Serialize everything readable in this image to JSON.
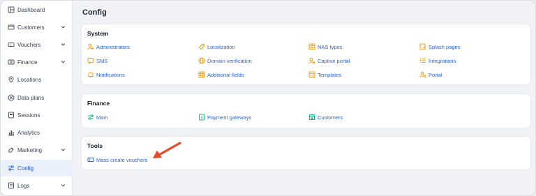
{
  "sidebar": {
    "items": [
      {
        "label": "Dashboard",
        "icon": "dashboard-icon"
      },
      {
        "label": "Customers",
        "icon": "customers-icon"
      },
      {
        "label": "Vouchers",
        "icon": "vouchers-icon"
      },
      {
        "label": "Finance",
        "icon": "finance-icon"
      },
      {
        "label": "Locations",
        "icon": "location-icon"
      },
      {
        "label": "Data plans",
        "icon": "data-plans-icon"
      },
      {
        "label": "Sessions",
        "icon": "sessions-icon"
      },
      {
        "label": "Analytics",
        "icon": "analytics-icon"
      },
      {
        "label": "Marketing",
        "icon": "marketing-icon"
      },
      {
        "label": "Config",
        "icon": "config-icon",
        "active": true
      },
      {
        "label": "Logs",
        "icon": "logs-icon"
      }
    ]
  },
  "page": {
    "title": "Config"
  },
  "system": {
    "title": "System",
    "links": [
      {
        "label": "Administrators",
        "icon": "administrators-icon"
      },
      {
        "label": "Localization",
        "icon": "localization-icon"
      },
      {
        "label": "NAS types",
        "icon": "nas-types-icon"
      },
      {
        "label": "Splash pages",
        "icon": "splash-pages-icon"
      },
      {
        "label": "SMS",
        "icon": "sms-icon"
      },
      {
        "label": "Domain verification",
        "icon": "globe-icon"
      },
      {
        "label": "Captive portal",
        "icon": "captive-portal-icon"
      },
      {
        "label": "Integrations",
        "icon": "integrations-icon"
      },
      {
        "label": "Notifications",
        "icon": "bell-icon"
      },
      {
        "label": "Additional fields",
        "icon": "additional-fields-icon"
      },
      {
        "label": "Templates",
        "icon": "templates-icon"
      },
      {
        "label": "Portal",
        "icon": "portal-icon"
      }
    ]
  },
  "finance": {
    "title": "Finance",
    "links": [
      {
        "label": "Main",
        "icon": "sliders-icon"
      },
      {
        "label": "Payment gateways",
        "icon": "payment-gateways-icon"
      },
      {
        "label": "Customers",
        "icon": "customers-store-icon"
      }
    ]
  },
  "tools": {
    "title": "Tools",
    "links": [
      {
        "label": "Mass create vouchers",
        "icon": "voucher-icon"
      }
    ]
  },
  "colors": {
    "orange": "#f59e0b",
    "green": "#10b981",
    "blue": "#2563eb",
    "arrow": "#ea4a2a"
  }
}
